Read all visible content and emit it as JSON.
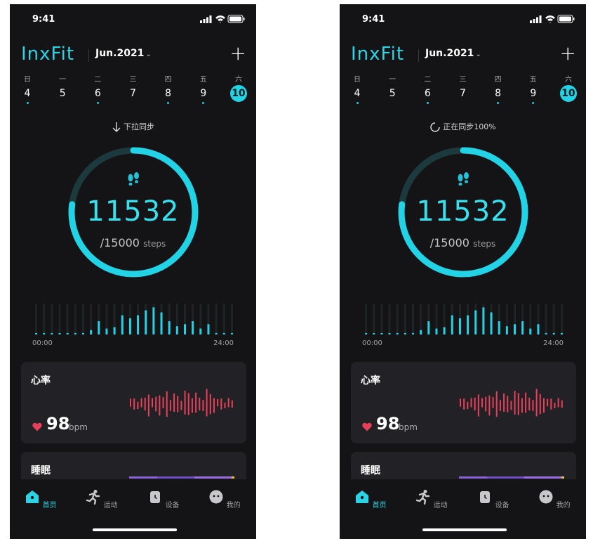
{
  "screens": [
    {
      "status": {
        "time": "9:41"
      },
      "header": {
        "logo": "InxFit",
        "month": "Jun.2021",
        "add_label": "+"
      },
      "week": [
        {
          "weekday": "日",
          "date": "4",
          "dot": true,
          "selected": false
        },
        {
          "weekday": "一",
          "date": "5",
          "dot": false,
          "selected": false
        },
        {
          "weekday": "二",
          "date": "6",
          "dot": true,
          "selected": false
        },
        {
          "weekday": "三",
          "date": "7",
          "dot": false,
          "selected": false
        },
        {
          "weekday": "四",
          "date": "8",
          "dot": true,
          "selected": false
        },
        {
          "weekday": "五",
          "date": "9",
          "dot": true,
          "selected": false
        },
        {
          "weekday": "六",
          "date": "10",
          "dot": true,
          "selected": true
        }
      ],
      "sync": {
        "text": "下拉同步",
        "icon": "arrow-down-icon"
      },
      "steps": {
        "value": "11532",
        "goal": "/15000",
        "unit": "steps",
        "progress": 0.77
      },
      "activity": {
        "start_label": "00:00",
        "end_label": "24:00",
        "values": [
          0,
          0,
          0,
          0,
          0.05,
          0.05,
          0.05,
          0.15,
          0.45,
          0.2,
          0.25,
          0.65,
          0.55,
          0.65,
          0.82,
          0.92,
          0.75,
          0.45,
          0.28,
          0.35,
          0.45,
          0.2,
          0.35,
          0.05,
          0.05,
          0
        ]
      },
      "heart": {
        "title": "心率",
        "value": "98",
        "unit": "bpm"
      },
      "sleep": {
        "title": "睡眠"
      },
      "tabs": [
        {
          "label": "首页",
          "icon": "home-icon",
          "active": true
        },
        {
          "label": "运动",
          "icon": "run-icon",
          "active": false
        },
        {
          "label": "设备",
          "icon": "watch-icon",
          "active": false
        },
        {
          "label": "我的",
          "icon": "profile-icon",
          "active": false
        }
      ]
    },
    {
      "status": {
        "time": "9:41"
      },
      "header": {
        "logo": "InxFit",
        "month": "Jun.2021",
        "add_label": "+"
      },
      "week": [
        {
          "weekday": "日",
          "date": "4",
          "dot": true,
          "selected": false
        },
        {
          "weekday": "一",
          "date": "5",
          "dot": false,
          "selected": false
        },
        {
          "weekday": "二",
          "date": "6",
          "dot": true,
          "selected": false
        },
        {
          "weekday": "三",
          "date": "7",
          "dot": false,
          "selected": false
        },
        {
          "weekday": "四",
          "date": "8",
          "dot": true,
          "selected": false
        },
        {
          "weekday": "五",
          "date": "9",
          "dot": true,
          "selected": false
        },
        {
          "weekday": "六",
          "date": "10",
          "dot": true,
          "selected": true
        }
      ],
      "sync": {
        "text": "正在同步100%",
        "icon": "spinner-icon"
      },
      "steps": {
        "value": "11532",
        "goal": "/15000",
        "unit": "steps",
        "progress": 0.77
      },
      "activity": {
        "start_label": "00:00",
        "end_label": "24:00",
        "values": [
          0,
          0,
          0,
          0,
          0.05,
          0.05,
          0.05,
          0.15,
          0.45,
          0.2,
          0.25,
          0.65,
          0.55,
          0.65,
          0.82,
          0.92,
          0.75,
          0.45,
          0.28,
          0.35,
          0.45,
          0.2,
          0.35,
          0.05,
          0.05,
          0
        ]
      },
      "heart": {
        "title": "心率",
        "value": "98",
        "unit": "bpm"
      },
      "sleep": {
        "title": "睡眠"
      },
      "tabs": [
        {
          "label": "首页",
          "icon": "home-icon",
          "active": true
        },
        {
          "label": "运动",
          "icon": "run-icon",
          "active": false
        },
        {
          "label": "设备",
          "icon": "watch-icon",
          "active": false
        },
        {
          "label": "我的",
          "icon": "profile-icon",
          "active": false
        }
      ]
    }
  ],
  "colors": {
    "accent": "#22d3e6",
    "heart": "#e8405a",
    "sleep": "#8a62d6"
  }
}
